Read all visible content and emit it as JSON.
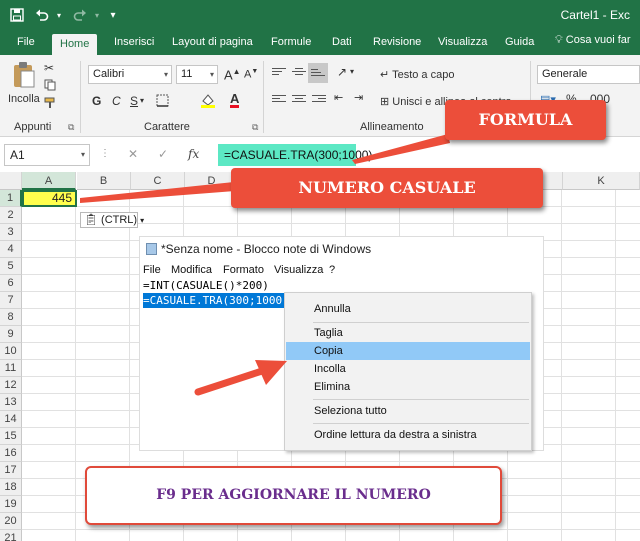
{
  "titlebar": {
    "app_title": "Cartel1 - Exc",
    "icons": [
      "save-icon",
      "undo-icon",
      "redo-icon",
      "customize-icon"
    ],
    "bg": "#217346"
  },
  "tabs": [
    {
      "label": "File",
      "active": false
    },
    {
      "label": "Home",
      "active": true
    },
    {
      "label": "Inserisci",
      "active": false
    },
    {
      "label": "Layout di pagina",
      "active": false
    },
    {
      "label": "Formule",
      "active": false
    },
    {
      "label": "Dati",
      "active": false
    },
    {
      "label": "Revisione",
      "active": false
    },
    {
      "label": "Visualizza",
      "active": false
    },
    {
      "label": "Guida",
      "active": false
    }
  ],
  "tell_me": "Cosa vuoi far",
  "ribbon": {
    "clipboard": {
      "paste_label": "Incolla",
      "group_label": "Appunti"
    },
    "font": {
      "family": "Calibri",
      "size": "11",
      "grow": "A",
      "shrink": "A",
      "bold": "G",
      "italic": "C",
      "underline": "S",
      "group_label": "Carattere"
    },
    "alignment": {
      "wrap_text": "Testo a capo",
      "merge": "Unisci e allinea al centro",
      "group_label": "Allineamento"
    },
    "number": {
      "format": "Generale"
    }
  },
  "formula_bar": {
    "name_box": "A1",
    "cancel": "✕",
    "enter": "✓",
    "fx": "fx",
    "formula": "=CASUALE.TRA(300;1000)"
  },
  "sheet": {
    "columns": [
      "A",
      "B",
      "C",
      "D",
      "E",
      "F",
      "G",
      "H",
      "I",
      "J",
      "K"
    ],
    "rows": [
      "1",
      "2",
      "3",
      "4",
      "5",
      "6",
      "7",
      "8",
      "9",
      "10",
      "11",
      "12",
      "13",
      "14",
      "15",
      "16",
      "17",
      "18",
      "19",
      "20",
      "21"
    ],
    "a1_value": "445",
    "a1_fill": "#ffff4d",
    "ctrl_tag": "(CTRL)"
  },
  "notepad": {
    "title": "*Senza nome - Blocco note di Windows",
    "menu": [
      "File",
      "Modifica",
      "Formato",
      "Visualizza",
      "?"
    ],
    "lines": [
      "=INT(CASUALE()*200)",
      "=CASUALE.TRA(300;1000)"
    ]
  },
  "context_menu": {
    "items": [
      "Annulla",
      "Taglia",
      "Copia",
      "Incolla",
      "Elimina",
      "Seleziona tutto",
      "Ordine lettura da destra a sinistra"
    ],
    "highlighted": "Copia"
  },
  "annotations": {
    "formula": "FORMULA",
    "random_number": "NUMERO CASUALE",
    "refresh": "F9 PER AGGIORNARE IL NUMERO",
    "callout_color": "#ec4e3a",
    "refresh_text_color": "#6a2d8d"
  }
}
